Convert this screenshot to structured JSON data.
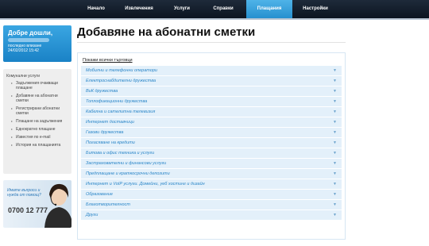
{
  "nav": {
    "items": [
      {
        "label": "Начало",
        "active": false
      },
      {
        "label": "Извлечения",
        "active": false
      },
      {
        "label": "Услуги",
        "active": false
      },
      {
        "label": "Справки",
        "active": false
      },
      {
        "label": "Плащания",
        "active": true
      },
      {
        "label": "Настройки",
        "active": false
      }
    ]
  },
  "welcome": {
    "greeting": "Добре дошли,",
    "last_login_label": "последно влизане",
    "last_login": "24/02/2012 15:42"
  },
  "sidebar": {
    "heading": "Комунални услуги",
    "items": [
      "Задължения очакващи плащане",
      "Добавяне на абонатни сметки",
      "Регистрирани абонатни сметки",
      "Плащане на задължения",
      "Еднократно плащане",
      "Известия по e-mail",
      "История на плащанията"
    ]
  },
  "support": {
    "question": "Имате въпроси и нужда от помощ?",
    "phone": "0700 12 777"
  },
  "main": {
    "title": "Добавяне на абонатни сметки",
    "show_all": "Покажи всички търговци",
    "categories": [
      "Мобилни и телефонни оператори",
      "Електроснабдителни дружества",
      "ВиК дружества",
      "Топлофикационни дружества",
      "Кабелна и сателитна телевизия",
      "Интернет доставчици",
      "Газови дружества",
      "Погасяване на кредити",
      "Битова и офис техника и услуги",
      "Застрахователни и финансови услуги",
      "Предплащане и краткосрочни депозити",
      "Интернет и VoIP услуги. Домейни, уеб хостинг и дизайн",
      "Образование",
      "Благотворителност",
      "Други"
    ]
  },
  "colors": {
    "accent": "#2690cf",
    "category_bg": "#e3f0fa",
    "category_text": "#2b86c8"
  }
}
